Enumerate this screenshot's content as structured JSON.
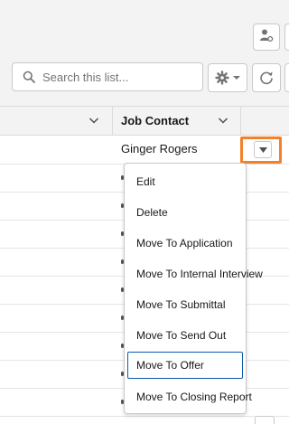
{
  "search": {
    "placeholder": "Search this list..."
  },
  "icons": {
    "contact": "person-settings-icon",
    "search": "search-icon",
    "settings": "gear-icon",
    "refresh": "refresh-icon",
    "column_menu": "chevron-down-icon",
    "row_action": "caret-down-icon"
  },
  "table": {
    "columns": [
      {
        "label": ""
      },
      {
        "label": "Job Contact"
      }
    ],
    "rows": [
      {
        "job_contact": "Ginger Rogers"
      }
    ]
  },
  "row_menu": {
    "items": [
      {
        "label": "Edit"
      },
      {
        "label": "Delete"
      },
      {
        "label": "Move To Application"
      },
      {
        "label": "Move To Internal Interview"
      },
      {
        "label": "Move To Submittal"
      },
      {
        "label": "Move To Send Out"
      },
      {
        "label": "Move To Offer",
        "focused": true
      },
      {
        "label": "Move To Closing Report"
      }
    ]
  },
  "colors": {
    "highlight": "#f4802a",
    "focus_border": "#0b5cab",
    "header_background": "#f3f3f3",
    "border": "#c9c9c9"
  }
}
